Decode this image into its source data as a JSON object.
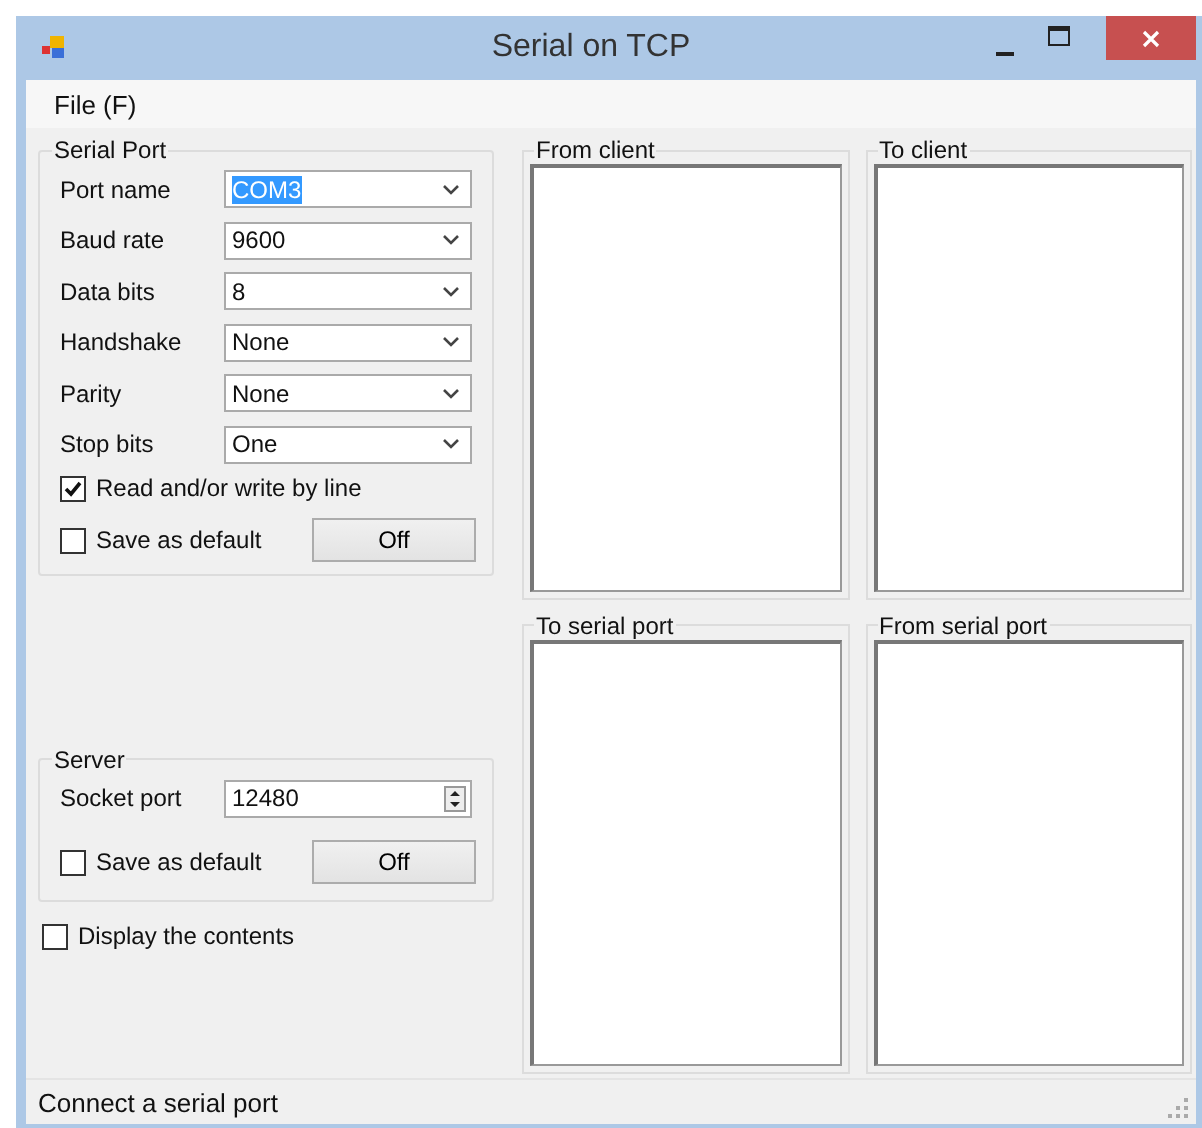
{
  "window": {
    "title": "Serial on TCP"
  },
  "menu": [
    "File (F)"
  ],
  "serial_port": {
    "title": "Serial Port",
    "fields": [
      {
        "label": "Port name",
        "value": "COM3",
        "text_selected": true
      },
      {
        "label": "Baud rate",
        "value": "9600",
        "text_selected": false
      },
      {
        "label": "Data bits",
        "value": "8",
        "text_selected": false
      },
      {
        "label": "Handshake",
        "value": "None",
        "text_selected": false
      },
      {
        "label": "Parity",
        "value": "None",
        "text_selected": false
      },
      {
        "label": "Stop bits",
        "value": "One",
        "text_selected": false
      }
    ],
    "by_line": {
      "label": "Read and/or write by line",
      "checked": true
    },
    "save_default": {
      "label": "Save as default",
      "checked": false
    },
    "button": "Off"
  },
  "server": {
    "title": "Server",
    "socket_port": {
      "label": "Socket port",
      "value": "12480"
    },
    "save_default": {
      "label": "Save as default",
      "checked": false
    },
    "button": "Off"
  },
  "display_contents": {
    "label": "Display the contents",
    "checked": false
  },
  "panels": [
    {
      "title": "From client"
    },
    {
      "title": "To client"
    },
    {
      "title": "To serial port"
    },
    {
      "title": "From serial port"
    }
  ],
  "status_bar": "Connect a serial port"
}
